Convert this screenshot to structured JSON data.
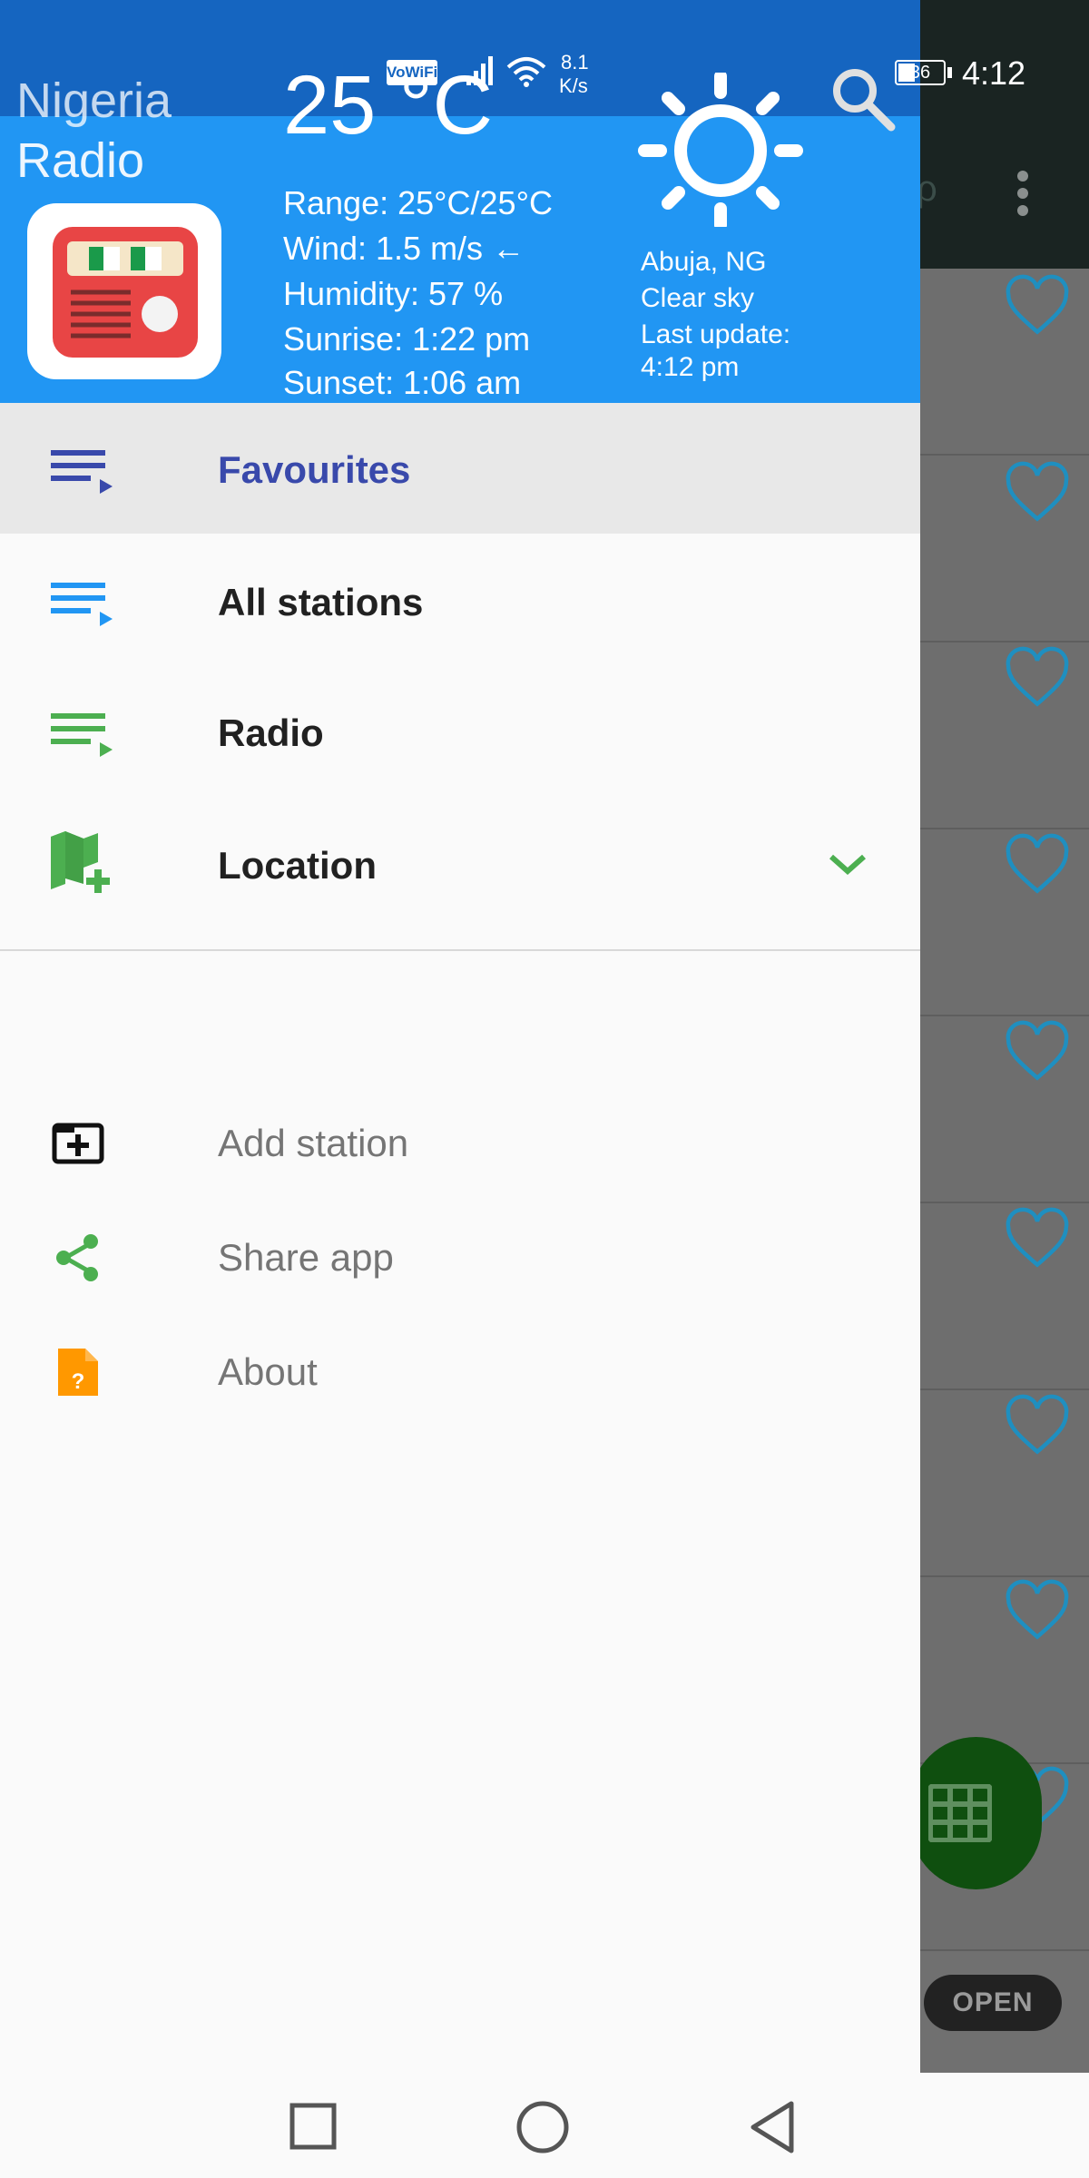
{
  "status_bar": {
    "vowifi": "VoWiFi",
    "speed_value": "8.1",
    "speed_unit": "K/s",
    "battery": "36",
    "time": "4:12"
  },
  "drawer_header": {
    "app_title_line1": "Nigeria",
    "app_title_line2": "Radio",
    "temperature": "25 °C",
    "range": "Range: 25°C/25°C",
    "wind": "Wind: 1.5 m/s ←",
    "humidity": "Humidity: 57 %",
    "sunrise": "Sunrise: 1:22 pm",
    "sunset": "Sunset: 1:06 am",
    "location": "Abuja, NG",
    "condition": "Clear sky",
    "last_update_label": "Last update:",
    "last_update_time": "4:12 pm",
    "weather_icon": "sun-icon"
  },
  "menu": {
    "items": [
      {
        "label": "Favourites",
        "icon": "playlist-icon",
        "selected": true
      },
      {
        "label": "All stations",
        "icon": "playlist-icon"
      },
      {
        "label": "Radio",
        "icon": "playlist-icon"
      },
      {
        "label": "Location",
        "icon": "map-add-icon",
        "expandable": true
      }
    ],
    "secondary": [
      {
        "label": "Add station",
        "icon": "add-box-icon"
      },
      {
        "label": "Share app",
        "icon": "share-icon"
      },
      {
        "label": "About",
        "icon": "help-file-icon"
      }
    ]
  },
  "background": {
    "open_button": "OPEN",
    "heart_icon": "heart-outline-icon",
    "fab_icon": "grid-icon"
  },
  "colors": {
    "header_blue": "#2196f3",
    "status_blue": "#1565c0",
    "favourites_accent": "#3949ab",
    "all_stations_accent": "#2196f3",
    "green_accent": "#4caf50",
    "about_orange": "#ff9800"
  }
}
